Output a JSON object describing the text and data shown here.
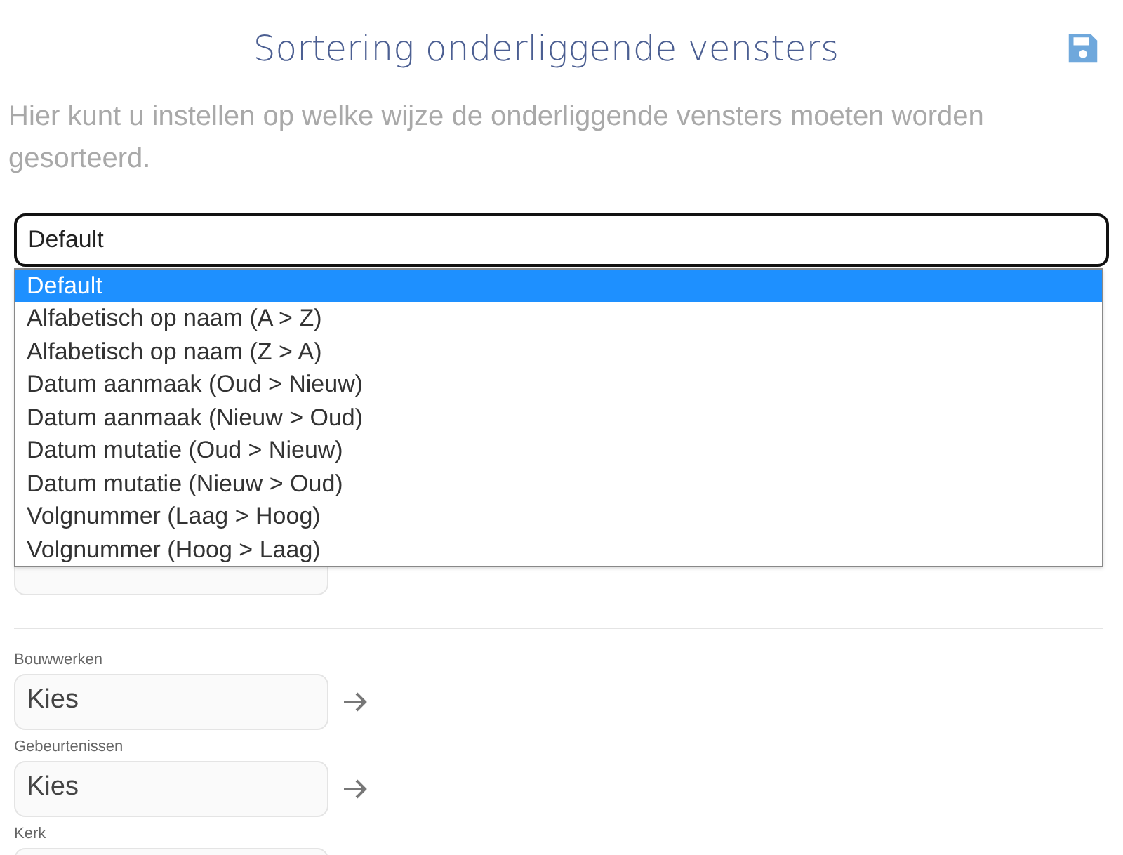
{
  "title": "Sortering onderliggende vensters",
  "description": "Hier kunt u instellen op welke wijze de onderliggende vensters moeten worden gesorteerd.",
  "sort_select": {
    "value": "Default",
    "expanded": true,
    "options": [
      {
        "label": "Default",
        "selected": true
      },
      {
        "label": "Alfabetisch op naam (A > Z)",
        "selected": false
      },
      {
        "label": "Alfabetisch op naam (Z > A)",
        "selected": false
      },
      {
        "label": "Datum aanmaak (Oud > Nieuw)",
        "selected": false
      },
      {
        "label": "Datum aanmaak (Nieuw > Oud)",
        "selected": false
      },
      {
        "label": "Datum mutatie (Oud > Nieuw)",
        "selected": false
      },
      {
        "label": "Datum mutatie (Nieuw > Oud)",
        "selected": false
      },
      {
        "label": "Volgnummer (Laag > Hoog)",
        "selected": false
      },
      {
        "label": "Volgnummer (Hoog > Laag)",
        "selected": false
      }
    ]
  },
  "fields": [
    {
      "label": "Bouwwerken",
      "value": "Kies",
      "arrow": true
    },
    {
      "label": "Gebeurtenissen",
      "value": "Kies",
      "arrow": true
    },
    {
      "label": "Kerk"
    }
  ]
}
